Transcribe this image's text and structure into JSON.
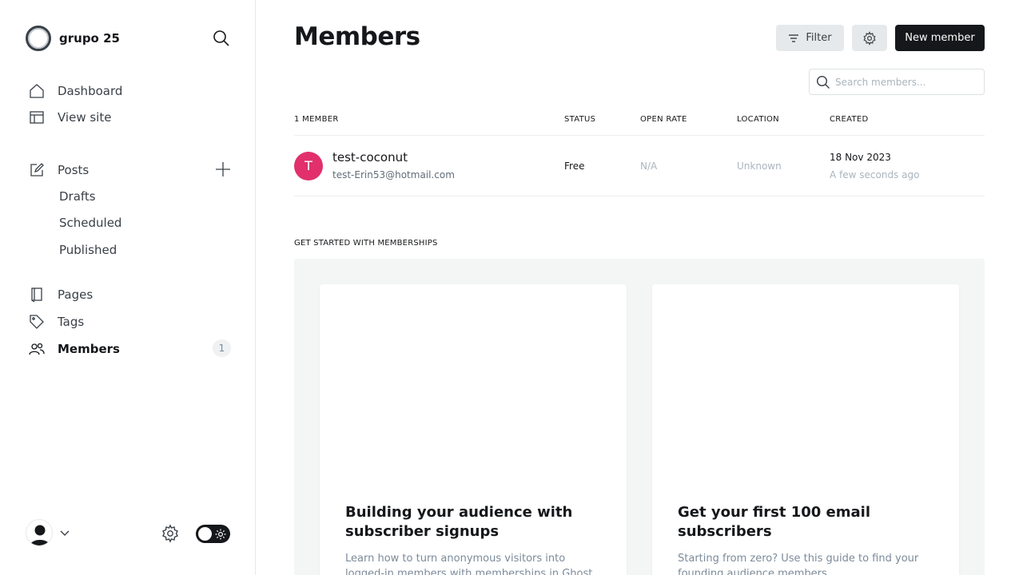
{
  "sidebar": {
    "site_name": "grupo 25",
    "nav": {
      "dashboard": "Dashboard",
      "view_site": "View site",
      "posts": "Posts",
      "drafts": "Drafts",
      "scheduled": "Scheduled",
      "published": "Published",
      "pages": "Pages",
      "tags": "Tags",
      "members": "Members",
      "members_count": "1"
    },
    "theme_toggle": "dark-mode-on"
  },
  "header": {
    "title": "Members",
    "filter_label": "Filter",
    "new_member_label": "New member"
  },
  "search": {
    "placeholder": "Search members...",
    "value": ""
  },
  "table": {
    "columns": [
      "1 MEMBER",
      "STATUS",
      "OPEN RATE",
      "LOCATION",
      "CREATED"
    ],
    "rows": [
      {
        "initial": "T",
        "name": "test-coconut",
        "email": "test-Erin53@hotmail.com",
        "status": "Free",
        "open_rate": "N/A",
        "location": "Unknown",
        "created_date": "18 Nov 2023",
        "created_ago": "A few seconds ago",
        "avatar_color": "#e1306c"
      }
    ]
  },
  "get_started": {
    "title": "GET STARTED WITH MEMBERSHIPS",
    "cards": [
      {
        "title": "Building your audience with subscriber signups",
        "description": "Learn how to turn anonymous visitors into logged-in members with memberships in Ghost."
      },
      {
        "title": "Get your first 100 email subscribers",
        "description": "Starting from zero? Use this guide to find your founding audience members."
      }
    ]
  },
  "colors": {
    "accent": "#15171a",
    "avatar": "#e1306c",
    "muted": "#aab4be"
  }
}
